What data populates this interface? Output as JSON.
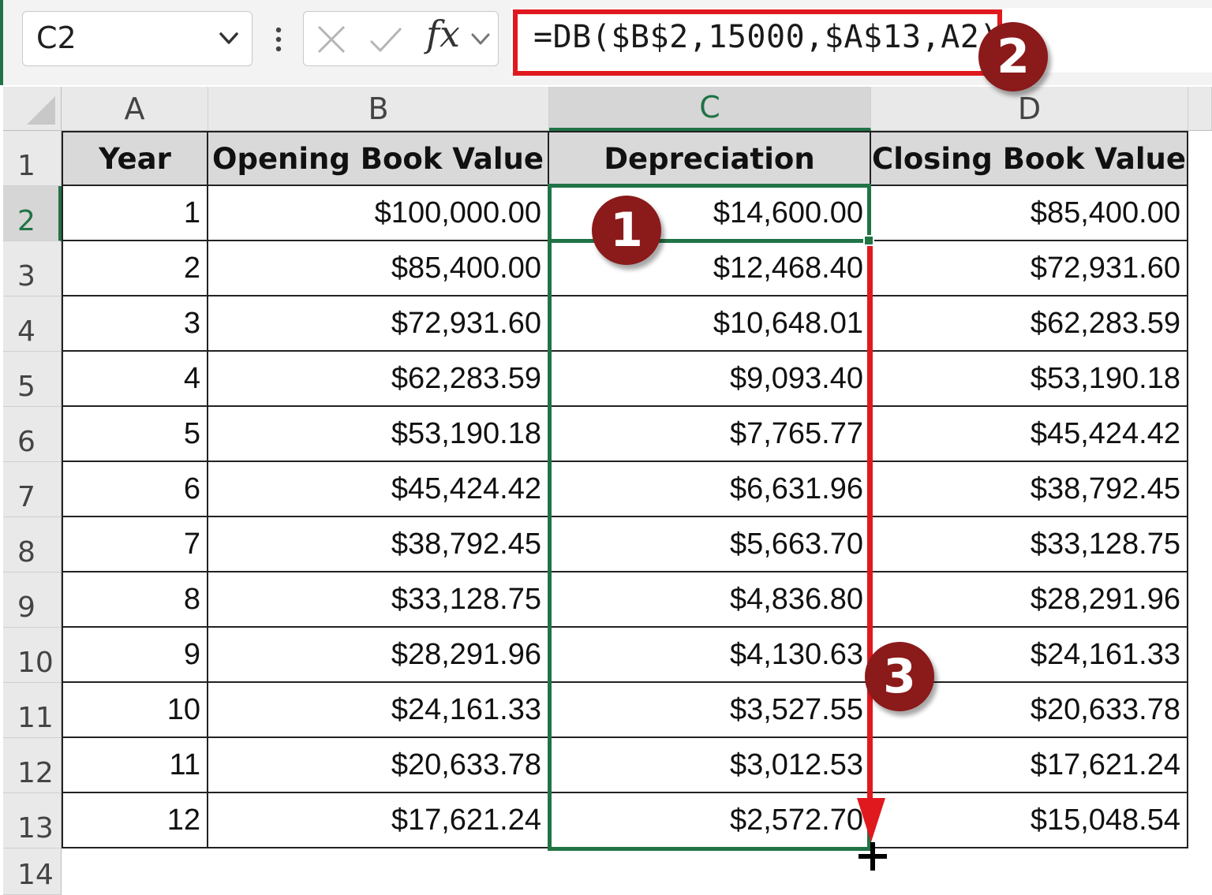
{
  "formula_bar": {
    "name_box": "C2",
    "formula": "=DB($B$2,15000,$A$13,A2)",
    "fx_label": "fx",
    "highlight_color": "#e0191f"
  },
  "annotations": {
    "badge_1": "1",
    "badge_2": "2",
    "badge_3": "3",
    "badge_color": "#8b1a1a",
    "arrow_color": "#e0191f"
  },
  "selection": {
    "active_cell": "C2",
    "range": "C2:C13",
    "color": "#217346"
  },
  "columns": [
    "A",
    "B",
    "C",
    "D"
  ],
  "rows": [
    "1",
    "2",
    "3",
    "4",
    "5",
    "6",
    "7",
    "8",
    "9",
    "10",
    "11",
    "12",
    "13",
    "14"
  ],
  "table": {
    "headers": [
      "Year",
      "Opening Book Value",
      "Depreciation",
      "Closing Book Value"
    ],
    "data": [
      [
        "1",
        "$100,000.00",
        "$14,600.00",
        "$85,400.00"
      ],
      [
        "2",
        "$85,400.00",
        "$12,468.40",
        "$72,931.60"
      ],
      [
        "3",
        "$72,931.60",
        "$10,648.01",
        "$62,283.59"
      ],
      [
        "4",
        "$62,283.59",
        "$9,093.40",
        "$53,190.18"
      ],
      [
        "5",
        "$53,190.18",
        "$7,765.77",
        "$45,424.42"
      ],
      [
        "6",
        "$45,424.42",
        "$6,631.96",
        "$38,792.45"
      ],
      [
        "7",
        "$38,792.45",
        "$5,663.70",
        "$33,128.75"
      ],
      [
        "8",
        "$33,128.75",
        "$4,836.80",
        "$28,291.96"
      ],
      [
        "9",
        "$28,291.96",
        "$4,130.63",
        "$24,161.33"
      ],
      [
        "10",
        "$24,161.33",
        "$3,527.55",
        "$20,633.78"
      ],
      [
        "11",
        "$20,633.78",
        "$3,012.53",
        "$17,621.24"
      ],
      [
        "12",
        "$17,621.24",
        "$2,572.70",
        "$15,048.54"
      ]
    ]
  }
}
